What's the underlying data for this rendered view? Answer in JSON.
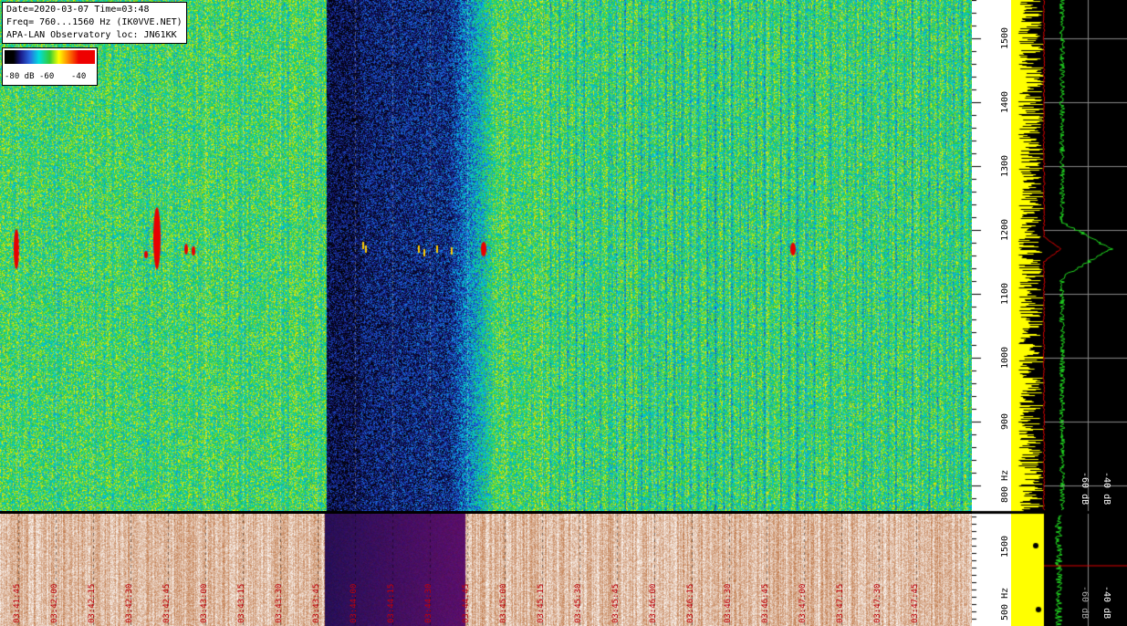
{
  "header": {
    "date_line": "Date=2020-03-07 Time=03:48",
    "freq_line": "Freq= 760...1560 Hz (IK0VVE.NET)",
    "loc_line": "APA-LAN Observatory loc: JN61KK"
  },
  "legend": {
    "labels": [
      "-80 dB",
      "-60",
      "-40"
    ]
  },
  "freq_axis": {
    "labels": [
      "1500",
      "1400",
      "1300",
      "1200",
      "1100",
      "1000",
      "900",
      "800 Hz"
    ],
    "values": [
      1500,
      1400,
      1300,
      1200,
      1100,
      1000,
      900,
      800
    ],
    "range": [
      760,
      1560
    ]
  },
  "lower_freq_axis": {
    "labels": [
      "1500",
      "500 Hz"
    ]
  },
  "time_axis": {
    "labels": [
      "03:41:45",
      "03:42:00",
      "03:42:15",
      "03:42:30",
      "03:42:45",
      "03:43:00",
      "03:43:15",
      "03:43:30",
      "03:43:45",
      "03:44:00",
      "03:44:15",
      "03:44:30",
      "03:44:45",
      "03:45:00",
      "03:45:15",
      "03:45:30",
      "03:45:45",
      "03:46:00",
      "03:46:15",
      "03:46:30",
      "03:46:45",
      "03:47:00",
      "03:47:15",
      "03:47:30",
      "03:47:45"
    ]
  },
  "spectrum_axis": {
    "upper_labels": [
      "-60 dB",
      "-40 dB"
    ],
    "lower_labels": [
      "-60 dB",
      "-40 dB"
    ]
  },
  "colors": {
    "trace_yellow": "#ffff00",
    "trace_green": "#22dd22",
    "trace_red": "#dd0000",
    "time_label": "#c0000a"
  },
  "chart_data": {
    "type": "heatmap",
    "x": "time",
    "y": "frequency (Hz)",
    "y_range": [
      760,
      1560
    ],
    "signal_dB_range": [
      -80,
      -40
    ],
    "echo_frequency_hz": 1170
  }
}
